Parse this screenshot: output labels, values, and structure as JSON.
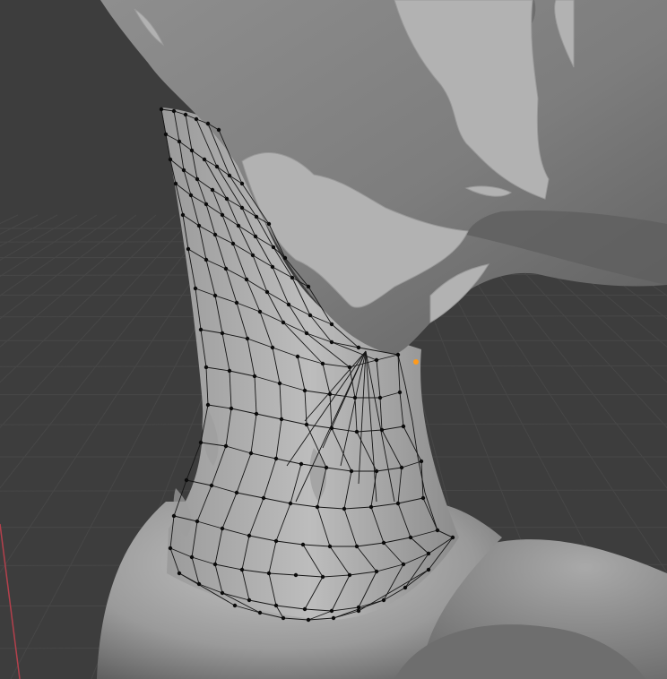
{
  "viewport": {
    "mode": "edit-mode",
    "background_color": "#3d3d3d",
    "grid_color": "#474747",
    "x_axis_color": "#b4404c",
    "object_color": "#8a8a8a",
    "retopo_mesh_color": "#cfcfcf",
    "vertex_color": "#0b0b0b",
    "selected_vertex_color": "#ff9a1a"
  },
  "objects": {
    "head": "sculpted-head",
    "neck": "neck-surface",
    "shoulders": "shoulder-surface",
    "retopo": "retopology-mesh"
  }
}
